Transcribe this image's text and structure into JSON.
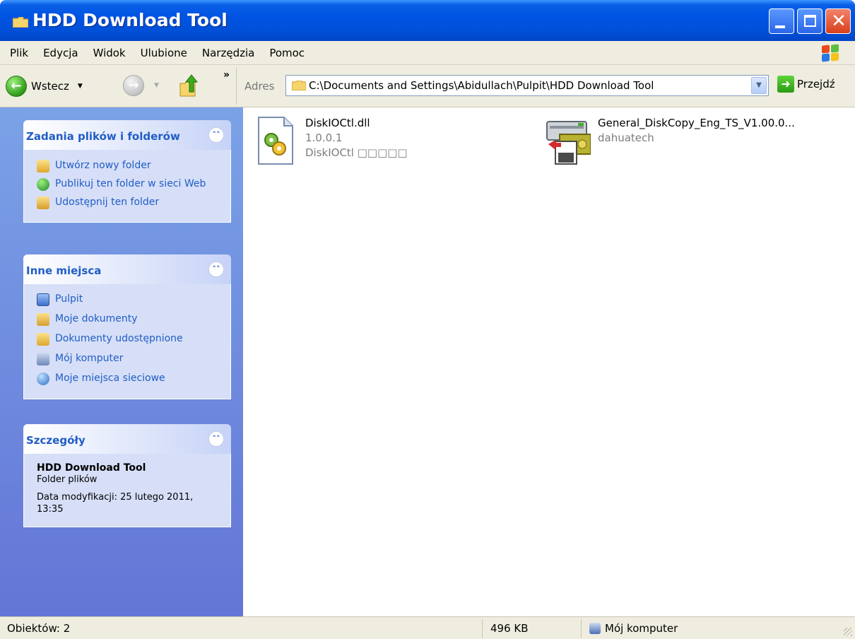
{
  "window": {
    "title": "HDD Download Tool",
    "close_glyph": "✕"
  },
  "menu": [
    "Plik",
    "Edycja",
    "Widok",
    "Ulubione",
    "Narzędzia",
    "Pomoc"
  ],
  "toolbar": {
    "back_label": "Wstecz",
    "more_glyph": "»",
    "address_label": "Adres",
    "address_value": "C:\\Documents and Settings\\Abidullach\\Pulpit\\HDD Download Tool",
    "go_label": "Przejdź"
  },
  "task_pane": {
    "file_tasks": {
      "title": "Zadania plików i folderów",
      "items": [
        {
          "label": "Utwórz nowy folder",
          "icon": "new-folder-icon"
        },
        {
          "label": "Publikuj ten folder w sieci Web",
          "icon": "publish-web-icon"
        },
        {
          "label": "Udostępnij ten folder",
          "icon": "share-folder-icon"
        }
      ]
    },
    "other_places": {
      "title": "Inne miejsca",
      "items": [
        {
          "label": "Pulpit",
          "icon": "desktop-icon"
        },
        {
          "label": "Moje dokumenty",
          "icon": "my-documents-icon"
        },
        {
          "label": "Dokumenty udostępnione",
          "icon": "shared-documents-icon"
        },
        {
          "label": "Mój komputer",
          "icon": "my-computer-icon"
        },
        {
          "label": "Moje miejsca sieciowe",
          "icon": "network-places-icon"
        }
      ]
    },
    "details": {
      "title": "Szczegóły",
      "name": "HDD Download Tool",
      "type": "Folder plików",
      "modified": "Data modyfikacji: 25 lutego 2011, 13:35"
    }
  },
  "files": [
    {
      "name": "DiskIOCtl.dll",
      "line2": "1.0.0.1",
      "line3": "DiskIOCtl □□□□□",
      "icon": "dll-file-icon"
    },
    {
      "name": "General_DiskCopy_Eng_TS_V1.00.0...",
      "line2": "dahuatech",
      "icon": "installer-exe-icon"
    }
  ],
  "status": {
    "objects": "Obiektów: 2",
    "size": "496 KB",
    "location": "Mój komputer"
  },
  "colors": {
    "titlebar": "#0054e3",
    "taskpane": "#7ba2e7",
    "link": "#215dc6",
    "chrome": "#efeddf"
  }
}
